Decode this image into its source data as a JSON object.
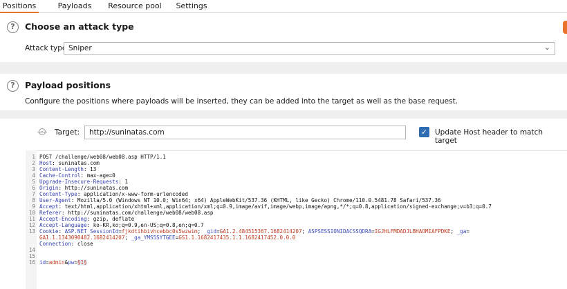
{
  "tabs": [
    {
      "label": "Positions",
      "active": true
    },
    {
      "label": "Payloads",
      "active": false
    },
    {
      "label": "Resource pool",
      "active": false
    },
    {
      "label": "Settings",
      "active": false
    }
  ],
  "attack": {
    "title": "Choose an attack type",
    "type_label": "Attack type:",
    "type_value": "Sniper"
  },
  "payload_positions": {
    "title": "Payload positions",
    "description": "Configure the positions where payloads will be inserted, they can be added into the target as well as the base request.",
    "target_label": "Target:",
    "target_value": "http://suninatas.com",
    "update_host_label": "Update Host header to match target",
    "update_host_checked": true
  },
  "request": {
    "line_numbers": [
      "1",
      "2",
      "3",
      "4",
      "5",
      "6",
      "7",
      "8",
      "9",
      "10",
      "11",
      "12",
      "13",
      "",
      "14",
      "15",
      "16"
    ],
    "request_line": "POST /challenge/web08/web08.asp HTTP/1.1",
    "headers": [
      {
        "key": "Host",
        "value": " suninatas.com"
      },
      {
        "key": "Content-Length",
        "value": " 13"
      },
      {
        "key": "Cache-Control",
        "value": " max-age=0"
      },
      {
        "key": "Upgrade-Insecure-Requests",
        "value": " 1"
      },
      {
        "key": "Origin",
        "value": " http://suninatas.com"
      },
      {
        "key": "Content-Type",
        "value": " application/x-www-form-urlencoded"
      },
      {
        "key": "User-Agent",
        "value": " Mozilla/5.0 (Windows NT 10.0; Win64; x64) AppleWebKit/537.36 (KHTML, like Gecko) Chrome/110.0.5481.78 Safari/537.36"
      },
      {
        "key": "Accept",
        "value": " text/html,application/xhtml+xml,application/xml;q=0.9,image/avif,image/webp,image/apng,*/*;q=0.8,application/signed-exchange;v=b3;q=0.7"
      },
      {
        "key": "Referer",
        "value": " http://suninatas.com/challenge/web08/web08.asp"
      },
      {
        "key": "Accept-Encoding",
        "value": " gzip, deflate"
      },
      {
        "key": "Accept-Language",
        "value": " ko-KR,ko;q=0.9,en-US;q=0.8,en;q=0.7"
      }
    ],
    "cookie": {
      "key": "Cookie",
      "p1_name": "ASP.NET_SessionId",
      "p1_value": "fjkdtihbivhcebbc0s5wzwim",
      "p2_name": "_gid",
      "p2_value": "GA1.2.484515367.1682414207",
      "p3_name": "ASPSESSIONIDACSSQDRA",
      "p3_value": "IGJHLFMDADJLBHAOMIAFPDKE",
      "p4_name": "_ga",
      "p4_value": "GA1.1.1343090482.1682414207",
      "p5_name": "_ga_YMS5SYTGEE",
      "p5_value": "GS1.1.1682417435.1.1.1682417452.0.0.0"
    },
    "connection": {
      "key": "Connection",
      "value": " close"
    },
    "body": {
      "k1": "id",
      "v1": "admin",
      "k2": "pw",
      "marker": "§1§"
    }
  }
}
